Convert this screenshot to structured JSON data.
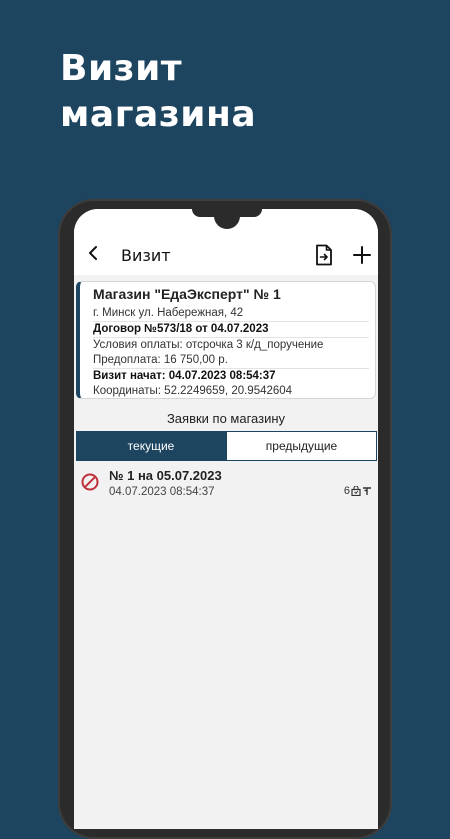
{
  "promo": {
    "headline_line1": "Визит",
    "headline_line2": "магазина"
  },
  "appbar": {
    "title": "Визит",
    "icons": [
      "back-icon",
      "export-document-icon",
      "add-icon"
    ]
  },
  "store_card": {
    "name": "Магазин \"ЕдаЭксперт\" № 1",
    "address": "г. Минск ул. Набережная, 42",
    "contract": "Договор №573/18 от 04.07.2023",
    "payment_terms": "Условия оплаты: отсрочка 3 к/д_поручение",
    "prepayment": "Предоплата: 16 750,00 р.",
    "visit_started": "Визит начат: 04.07.2023 08:54:37",
    "coordinates": "Координаты: 52.2249659, 20.9542604"
  },
  "orders_section": {
    "title": "Заявки по магазину",
    "tabs": [
      {
        "label": "текущие",
        "active": true
      },
      {
        "label": "предыдущие",
        "active": false
      }
    ]
  },
  "orders": [
    {
      "title": "№ 1 на 05.07.2023",
      "date": "04.07.2023 08:54:37",
      "count": "6",
      "status_icon": "cancel-icon",
      "meta_icons": [
        "bag-icon",
        "pin-icon"
      ]
    }
  ],
  "colors": {
    "background": "#1d4560",
    "accent": "#1d4560",
    "cancel": "#c0303a"
  }
}
